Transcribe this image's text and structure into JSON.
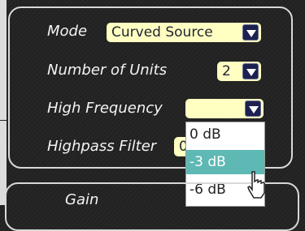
{
  "controls": {
    "mode": {
      "label": "Mode",
      "value": "Curved Source"
    },
    "units": {
      "label": "Number of Units",
      "value": "2"
    },
    "high_frequency": {
      "label": "High Frequency",
      "value": "",
      "options": [
        "0 dB",
        "-3 dB",
        "-6 dB"
      ],
      "highlighted": "-3 dB"
    },
    "highpass": {
      "label": "Highpass Filter",
      "value": "0"
    }
  },
  "gain": {
    "label": "Gain"
  },
  "colors": {
    "select_bg": "#ffffc2",
    "arrow_bg": "#1c2150",
    "highlight": "#5eb8b3",
    "background": "#222222"
  }
}
